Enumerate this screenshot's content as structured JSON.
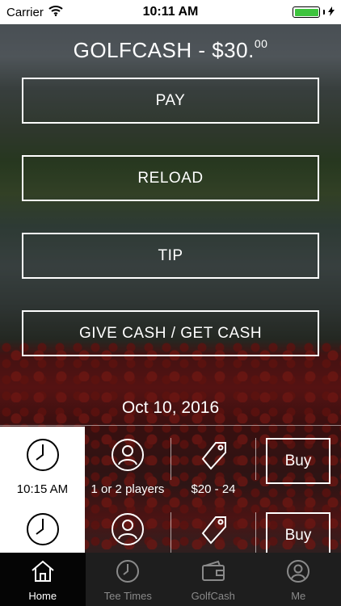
{
  "status": {
    "carrier": "Carrier",
    "time": "10:11 AM",
    "battery_level": 1.0,
    "battery_color": "#3ec43e"
  },
  "header": {
    "title_main": "GOLFCASH - $30.",
    "title_cents": "00"
  },
  "actions": {
    "pay": "PAY",
    "reload": "RELOAD",
    "tip": "TIP",
    "give_get": "GIVE CASH / GET CASH"
  },
  "tee_times": {
    "date": "Oct 10, 2016",
    "rows": [
      {
        "time": "10:15 AM",
        "players": "1 or 2 players",
        "price": "$20 - 24",
        "buy_label": "Buy"
      },
      {
        "time": "",
        "players": "",
        "price": "",
        "buy_label": "Buy"
      }
    ]
  },
  "tabs": [
    {
      "label": "Home",
      "icon": "home-icon",
      "active": true
    },
    {
      "label": "Tee Times",
      "icon": "clock-icon",
      "active": false
    },
    {
      "label": "GolfCash",
      "icon": "wallet-icon",
      "active": false
    },
    {
      "label": "Me",
      "icon": "user-icon",
      "active": false
    }
  ]
}
